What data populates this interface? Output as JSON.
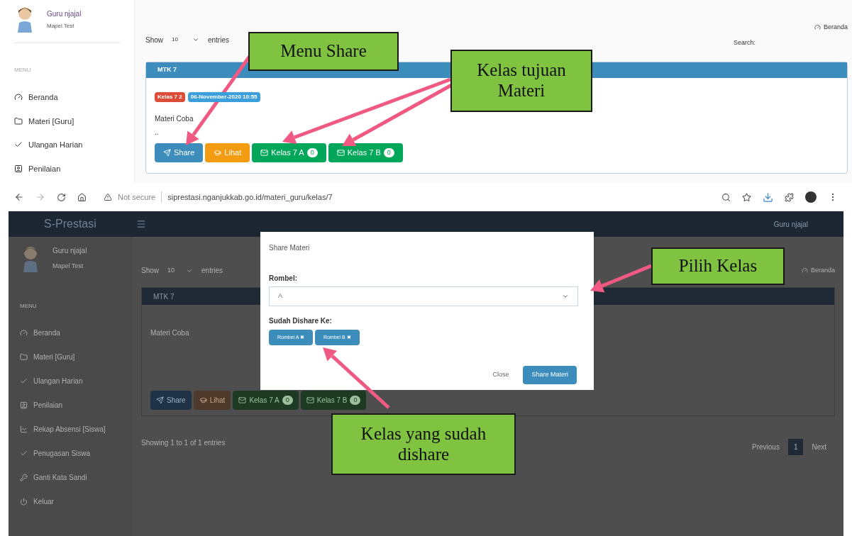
{
  "top_screen": {
    "user": {
      "name": "Guru njajal",
      "subject": "Mapel Test"
    },
    "menu_label": "MENU",
    "sidebar": [
      {
        "label": "Beranda"
      },
      {
        "label": "Materi [Guru]"
      },
      {
        "label": "Ulangan Harian"
      },
      {
        "label": "Penilaian"
      }
    ],
    "breadcrumb": "Beranda",
    "length": {
      "before": "Show",
      "value": "10",
      "after": "entries"
    },
    "search_label": "Search:",
    "card": {
      "title": "MTK 7",
      "badges": [
        {
          "text": "Kelas 7 2",
          "color": "#dd4b39"
        },
        {
          "text": "06-November-2020 10:55",
          "color": "#3c9fdc"
        }
      ],
      "text": "Materi Coba",
      "excerpt": "..",
      "buttons": [
        {
          "kind": "share",
          "label": "Share"
        },
        {
          "kind": "view",
          "label": "Lihat"
        },
        {
          "kind": "class",
          "label": "Kelas 7 A",
          "count": "0"
        },
        {
          "kind": "class",
          "label": "Kelas 7 B",
          "count": "0"
        }
      ]
    }
  },
  "browser": {
    "security": "Not secure",
    "url": "siprestasi.nganjukkab.go.id/materi_guru/kelas/7"
  },
  "bottom_screen": {
    "brand": "S-Prestasi",
    "header_user": "Guru njajal",
    "user": {
      "name": "Guru njajal",
      "subject": "Mapel Test"
    },
    "menu_label": "MENU",
    "sidebar": [
      {
        "label": "Beranda"
      },
      {
        "label": "Materi [Guru]"
      },
      {
        "label": "Ulangan Harian"
      },
      {
        "label": "Penilaian"
      },
      {
        "label": "Rekap Absensi [Siswa]"
      },
      {
        "label": "Penugasan Siswa"
      },
      {
        "label": "Ganti Kata Sandi"
      },
      {
        "label": "Keluar"
      }
    ],
    "breadcrumb": "Beranda",
    "length": {
      "before": "Show",
      "value": "10",
      "after": "entries"
    },
    "card": {
      "title": "MTK 7",
      "text": "Materi Coba",
      "buttons": [
        {
          "kind": "share",
          "label": "Share"
        },
        {
          "kind": "view",
          "label": "Lihat"
        },
        {
          "kind": "class",
          "label": "Kelas 7 A",
          "count": "0"
        },
        {
          "kind": "class",
          "label": "Kelas 7 B",
          "count": "0"
        }
      ]
    },
    "info": "Showing 1 to 1 of 1 entries",
    "pagination": [
      {
        "label": "Previous",
        "selected": false
      },
      {
        "label": "1",
        "selected": true
      },
      {
        "label": "Next",
        "selected": false
      }
    ]
  },
  "modal": {
    "title": "Share Materi",
    "field_label": "Rombel:",
    "field_value": "A",
    "shared_label": "Sudah Dishare Ke:",
    "shared": [
      {
        "label": "Rombel A"
      },
      {
        "label": "Rombel B"
      }
    ],
    "remove_glyph": "✖",
    "buttons": [
      {
        "kind": "secondary",
        "label": "Close"
      },
      {
        "kind": "primary",
        "label": "Share Materi"
      }
    ]
  },
  "callouts": [
    {
      "text": "Menu Share"
    },
    {
      "text": "Kelas tujuan Materi"
    },
    {
      "text": "Pilih Kelas"
    },
    {
      "text": "Kelas yang sudah dishare"
    }
  ]
}
